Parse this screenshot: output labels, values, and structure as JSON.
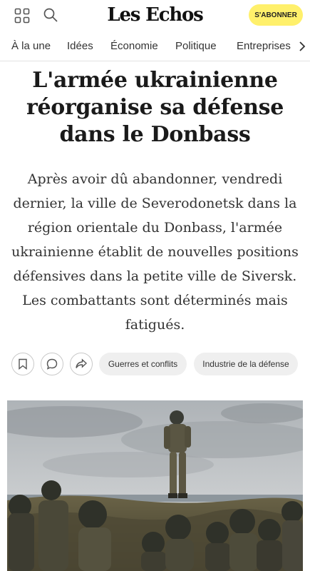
{
  "header": {
    "logo": "Les Echos",
    "subscribe_label": "S'ABONNER",
    "menu_icon": "grid-icon",
    "search_icon": "search-icon"
  },
  "nav": {
    "items": [
      "À la une",
      "Idées",
      "Économie",
      "Politique",
      "Entreprises"
    ],
    "more_icon": "chevron-right-icon"
  },
  "article": {
    "title": "L'armée ukrainienne réorganise sa défense dans le Donbass",
    "lead": "Après avoir dû abandonner, vendredi dernier, la ville de Severodonetsk dans la région orientale du Donbass, l'armée ukrainienne établit de nouvelles positions défensives dans la petite ville de Siversk. Les combattants sont déterminés mais fatigués.",
    "actions": [
      "bookmark-icon",
      "comment-icon",
      "share-icon"
    ],
    "tags": [
      "Guerres et conflits",
      "Industrie de la défense"
    ]
  },
  "colors": {
    "subscribe_bg": "#fff06b",
    "tag_bg": "#efefef"
  }
}
